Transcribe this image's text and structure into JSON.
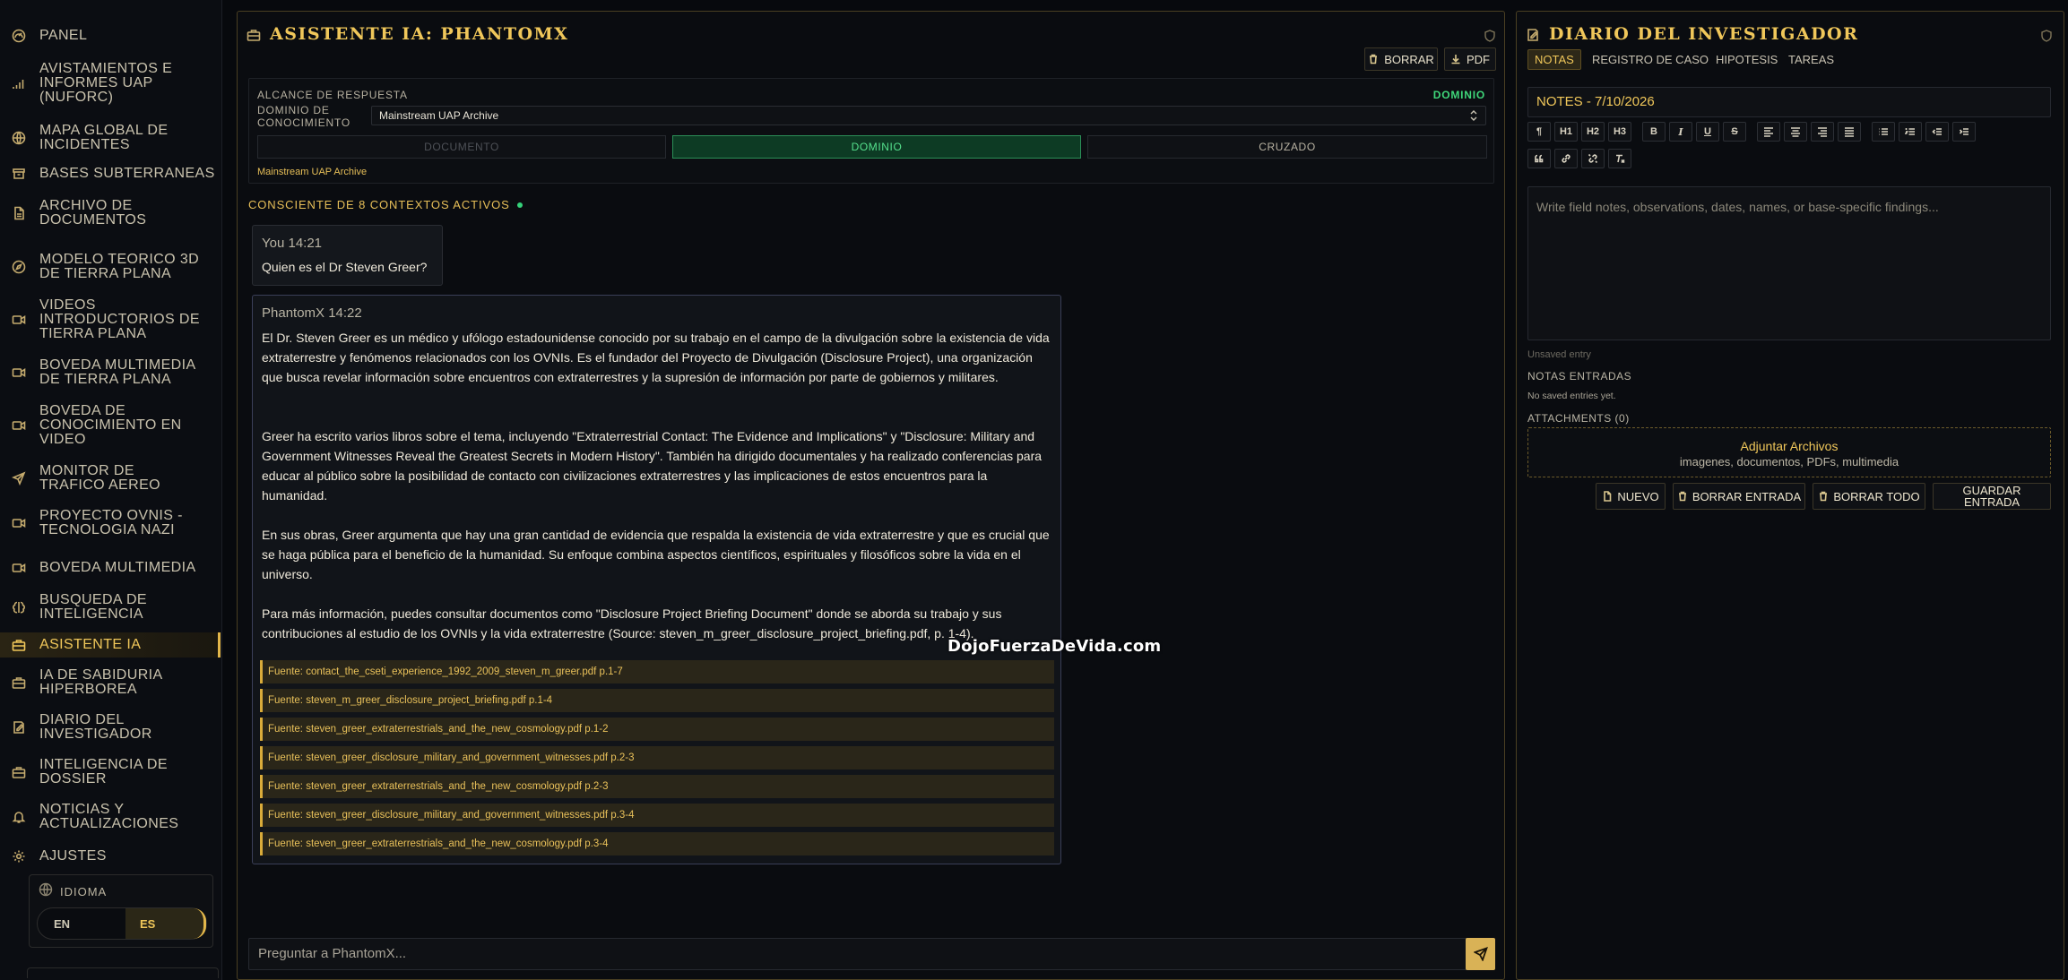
{
  "sidebar": {
    "items": [
      {
        "label": "PANEL",
        "icon": "gauge-icon"
      },
      {
        "label": "AVISTAMIENTOS E INFORMES UAP (NUFORC)",
        "icon": "signal-bars-icon"
      },
      {
        "label": "MAPA GLOBAL DE INCIDENTES",
        "icon": "globe-icon"
      },
      {
        "label": "BASES SUBTERRANEAS",
        "icon": "archive-box-icon"
      },
      {
        "label": "ARCHIVO DE DOCUMENTOS",
        "icon": "document-icon"
      },
      {
        "label": "MODELO TEORICO 3D DE TIERRA PLANA",
        "icon": "compass-icon"
      },
      {
        "label": "VIDEOS INTRODUCTORIOS DE TIERRA PLANA",
        "icon": "video-camera-icon"
      },
      {
        "label": "BOVEDA MULTIMEDIA DE TIERRA PLANA",
        "icon": "video-camera-icon"
      },
      {
        "label": "BOVEDA DE CONOCIMIENTO EN VIDEO",
        "icon": "video-camera-icon"
      },
      {
        "label": "MONITOR DE TRAFICO AEREO",
        "icon": "plane-icon"
      },
      {
        "label": "PROYECTO OVNIS - TECNOLOGIA NAZI",
        "icon": "video-camera-icon"
      },
      {
        "label": "BOVEDA MULTIMEDIA",
        "icon": "video-camera-icon"
      },
      {
        "label": "BUSQUEDA DE INTELIGENCIA",
        "icon": "brain-icon"
      },
      {
        "label": "ASISTENTE IA",
        "icon": "briefcase-icon",
        "active": true
      },
      {
        "label": "IA DE SABIDURIA HIPERBOREA",
        "icon": "briefcase-icon"
      },
      {
        "label": "DIARIO DEL INVESTIGADOR",
        "icon": "notebook-icon"
      },
      {
        "label": "INTELIGENCIA DE DOSSIER",
        "icon": "briefcase-icon"
      },
      {
        "label": "NOTICIAS Y ACTUALIZACIONES",
        "icon": "bell-icon"
      },
      {
        "label": "AJUSTES",
        "icon": "gear-icon"
      }
    ],
    "language": {
      "label": "IDIOMA",
      "en": "EN",
      "es": "ES",
      "selected": "ES"
    }
  },
  "chat": {
    "title": "ASISTENTE IA: PHANTOMX",
    "clear_label": "BORRAR",
    "pdf_label": "PDF",
    "scope": {
      "title": "ALCANCE DE RESPUESTA",
      "mode": "DOMINIO",
      "domain_label": "DOMINIO DE CONOCIMIENTO",
      "domain_value": "Mainstream UAP Archive",
      "segments": [
        "DOCUMENTO",
        "DOMINIO",
        "CRUZADO"
      ],
      "selected_text": "Mainstream UAP Archive"
    },
    "aware_text": "CONSCIENTE DE 8 CONTEXTOS ACTIVOS",
    "user_msg": {
      "who": "You 14:21",
      "text": "Quien es el Dr Steven Greer?"
    },
    "bot_msg": {
      "who": "PhantomX 14:22",
      "paragraphs": [
        "El Dr. Steven Greer es un médico y ufólogo estadounidense conocido por su trabajo en el campo de la divulgación sobre la existencia de vida extraterrestre y fenómenos relacionados con los OVNIs. Es el fundador del Proyecto de Divulgación (Disclosure Project), una organización que busca revelar información sobre encuentros con extraterrestres y la supresión de información por parte de gobiernos y militares.",
        "Greer ha escrito varios libros sobre el tema, incluyendo \"Extraterrestrial Contact: The Evidence and Implications\" y \"Disclosure: Military and Government Witnesses Reveal the Greatest Secrets in Modern History\". También ha dirigido documentales y ha realizado conferencias para educar al público sobre la posibilidad de contacto con civilizaciones extraterrestres y las implicaciones de estos encuentros para la humanidad.",
        "En sus obras, Greer argumenta que hay una gran cantidad de evidencia que respalda la existencia de vida extraterrestre y que es crucial que se haga pública para el beneficio de la humanidad. Su enfoque combina aspectos científicos, espirituales y filosóficos sobre la vida en el universo.",
        "Para más información, puedes consultar documentos como \"Disclosure Project Briefing Document\" donde se aborda su trabajo y sus contribuciones al estudio de los OVNIs y la vida extraterrestre (Source: steven_m_greer_disclosure_project_briefing.pdf, p. 1-4)."
      ],
      "sources": [
        "Fuente: contact_the_cseti_experience_1992_2009_steven_m_greer.pdf p.1-7",
        "Fuente: steven_m_greer_disclosure_project_briefing.pdf p.1-4",
        "Fuente: steven_greer_extraterrestrials_and_the_new_cosmology.pdf p.1-2",
        "Fuente: steven_greer_disclosure_military_and_government_witnesses.pdf p.2-3",
        "Fuente: steven_greer_extraterrestrials_and_the_new_cosmology.pdf p.2-3",
        "Fuente: steven_greer_disclosure_military_and_government_witnesses.pdf p.3-4",
        "Fuente: steven_greer_extraterrestrials_and_the_new_cosmology.pdf p.3-4"
      ]
    },
    "watermark": "DojoFuerzaDeVida.com",
    "input_placeholder": "Preguntar a PhantomX..."
  },
  "journal": {
    "title": "DIARIO DEL INVESTIGADOR",
    "tabs": [
      "NOTAS",
      "REGISTRO DE CASO",
      "HIPOTESIS",
      "TAREAS"
    ],
    "active_tab": "NOTAS",
    "note_title": "NOTES - 7/10/2026",
    "editor_placeholder": "Write field notes, observations, dates, names, or base-specific findings...",
    "unsaved": "Unsaved entry",
    "saved_title": "NOTAS ENTRADAS",
    "saved_empty": "No saved entries yet.",
    "attachments_title": "ATTACHMENTS (0)",
    "attach_main": "Adjuntar Archivos",
    "attach_sub": "imagenes, documentos, PDFs, multimedia",
    "buttons": {
      "new": "NUEVO",
      "delete_entry": "BORRAR ENTRADA",
      "delete_all": "BORRAR TODO",
      "save_line1": "GUARDAR",
      "save_line2": "ENTRADA"
    },
    "toolbar_text": {
      "h1": "H1",
      "h2": "H2",
      "h3": "H3",
      "bold": "B",
      "italic": "I",
      "underline": "U",
      "strike": "S"
    }
  },
  "colors": {
    "accent": "#f0c75a",
    "active_green": "#3fd77a",
    "panel_border": "#4a3f22"
  }
}
